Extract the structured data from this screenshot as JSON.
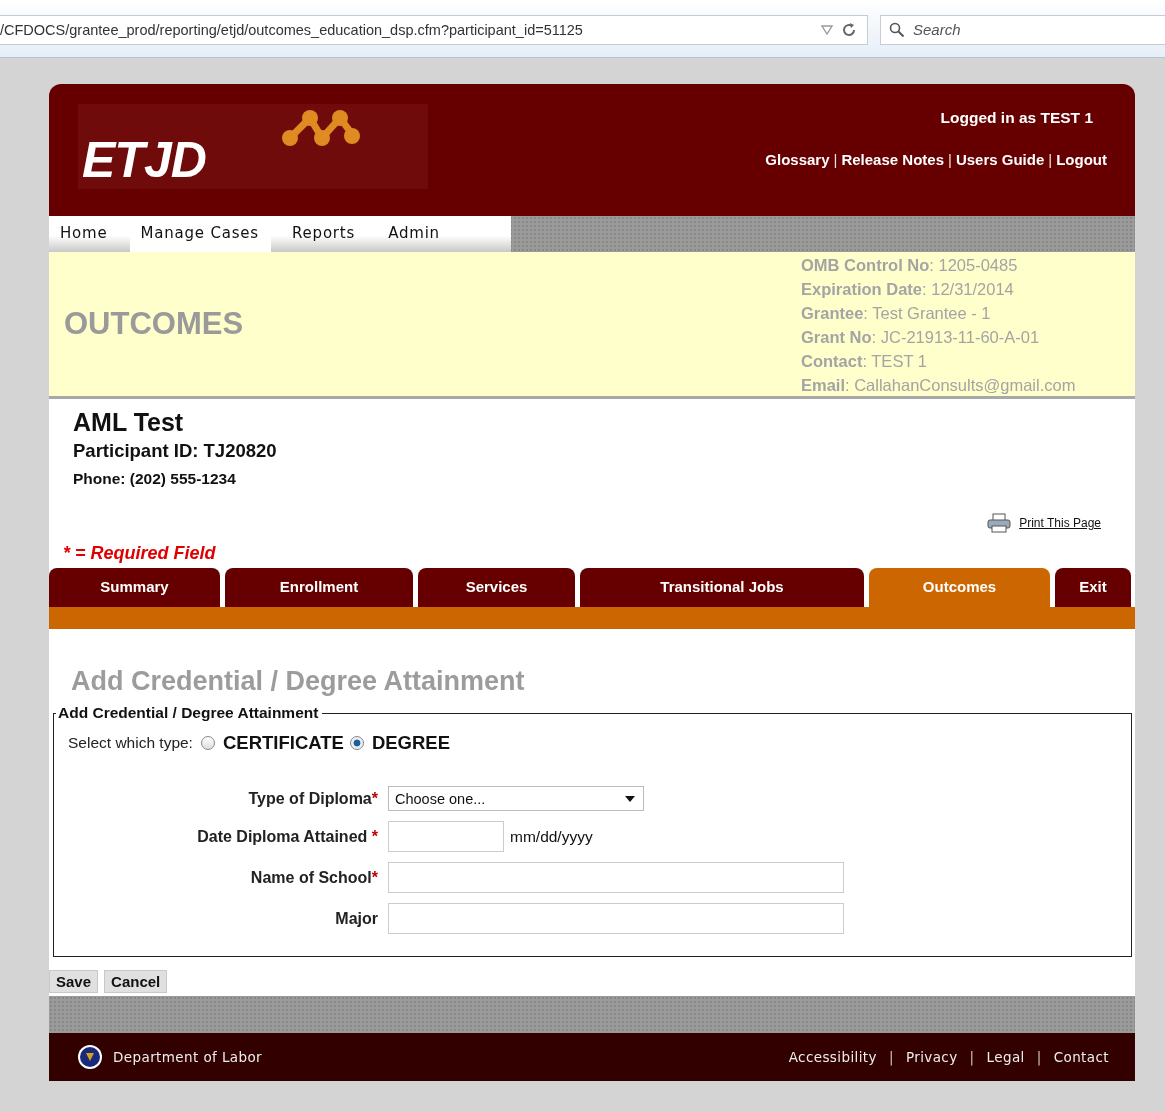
{
  "browser": {
    "url": "/CFDOCS/grantee_prod/reporting/etjd/outcomes_education_dsp.cfm?participant_id=51125",
    "search": {
      "placeholder": "Search"
    }
  },
  "header": {
    "logo": "ETJD",
    "logged_in": "Logged in as TEST 1",
    "links": [
      {
        "kind": "link",
        "text": "Glossary"
      },
      {
        "kind": "separator",
        "text": "|"
      },
      {
        "kind": "link",
        "text": "Release Notes"
      },
      {
        "kind": "separator",
        "text": "|"
      },
      {
        "kind": "link",
        "text": "Users Guide"
      },
      {
        "kind": "separator",
        "text": "|"
      },
      {
        "kind": "link",
        "text": "Logout"
      }
    ]
  },
  "nav": [
    {
      "label": "Home",
      "selected": false
    },
    {
      "label": "Manage Cases",
      "selected": true
    },
    {
      "label": "Reports",
      "selected": false
    },
    {
      "label": "Admin",
      "selected": false
    }
  ],
  "banner": {
    "title": "OUTCOMES",
    "info": [
      {
        "label": "OMB Control No",
        "value": ": 1205-0485"
      },
      {
        "label": "Expiration Date",
        "value": ": 12/31/2014"
      },
      {
        "label": "Grantee",
        "value": ": Test Grantee - 1"
      },
      {
        "label": "Grant No",
        "value": ": JC-21913-11-60-A-01"
      },
      {
        "label": "Contact",
        "value": ": TEST 1"
      },
      {
        "label": "Email",
        "value": ": CallahanConsults@gmail.com"
      }
    ]
  },
  "participant": {
    "name": "AML Test",
    "id": "Participant ID: TJ20820",
    "phone": "Phone: (202) 555-1234"
  },
  "print_link": "Print This Page",
  "required_note": "* = Required Field",
  "tabs": [
    {
      "label": "Summary",
      "selected": false
    },
    {
      "label": "Enrollment",
      "selected": false
    },
    {
      "label": "Services",
      "selected": false
    },
    {
      "label": "Transitional Jobs",
      "selected": false
    },
    {
      "label": "Outcomes",
      "selected": true
    },
    {
      "label": "Exit",
      "selected": false
    }
  ],
  "heading": "Add Credential / Degree Attainment",
  "fieldset": {
    "legend": "Add Credential / Degree Attainment",
    "type_label": "Select which type:",
    "type_options": [
      {
        "label": "CERTIFICATE",
        "selected": false
      },
      {
        "label": "DEGREE",
        "selected": true
      }
    ],
    "rows": [
      {
        "label": "Type of Diploma",
        "required_mark": "*",
        "kind": "select",
        "value": "Choose one..."
      },
      {
        "label": "Date Diploma Attained ",
        "required_mark": "*",
        "kind": "date",
        "hint": "mm/dd/yyyy"
      },
      {
        "label": "Name of School",
        "required_mark": "*",
        "kind": "text"
      },
      {
        "label": "Major",
        "kind": "text"
      }
    ]
  },
  "buttons": [
    "Save",
    "Cancel"
  ],
  "footer": {
    "agency": "Department of Labor",
    "links": [
      {
        "kind": "link",
        "text": "Accessibility"
      },
      {
        "kind": "separator",
        "text": "|"
      },
      {
        "kind": "link",
        "text": "Privacy"
      },
      {
        "kind": "separator",
        "text": "|"
      },
      {
        "kind": "link",
        "text": "Legal"
      },
      {
        "kind": "separator",
        "text": "|"
      },
      {
        "kind": "link",
        "text": "Contact"
      }
    ]
  }
}
